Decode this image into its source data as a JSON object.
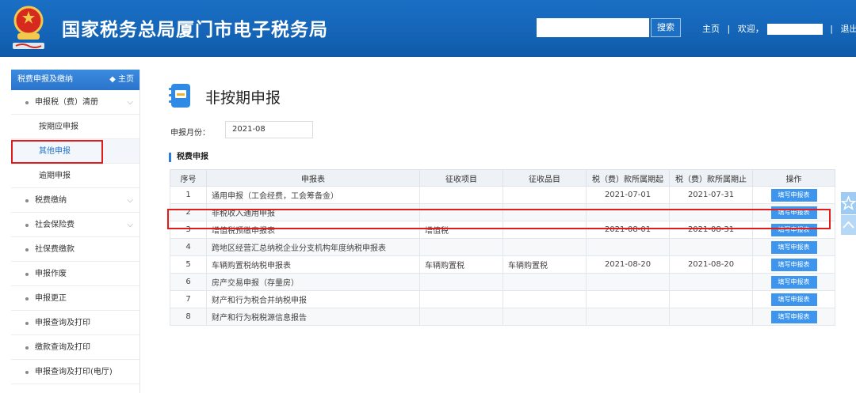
{
  "header": {
    "title": "国家税务总局厦门市电子税务局",
    "search_button": "搜索",
    "nav_home": "主页",
    "nav_sep": "|",
    "nav_welcome": "欢迎，",
    "nav_logout": "退出",
    "brand_color": "#1565b8"
  },
  "sidebar": {
    "head_label": "税费申报及缴纳",
    "head_home": "主页",
    "groups": [
      {
        "label": "申报税（费）清册",
        "chevron": "⌵"
      },
      {
        "label": "税费缴纳",
        "chevron": "⌵"
      },
      {
        "label": "社会保险费",
        "chevron": "⌵"
      },
      {
        "label": "社保费缴款"
      },
      {
        "label": "申报作废"
      },
      {
        "label": "申报更正"
      },
      {
        "label": "申报查询及打印"
      },
      {
        "label": "缴款查询及打印"
      },
      {
        "label": "申报查询及打印(电厅)"
      }
    ],
    "subitems": [
      {
        "label": "按期应申报"
      },
      {
        "label": "其他申报"
      },
      {
        "label": "逾期申报"
      }
    ]
  },
  "main": {
    "page_title": "非按期申报",
    "month_label": "申报月份：",
    "month_value": "2021-08",
    "section_title": "税费申报",
    "columns": [
      "序号",
      "申报表",
      "征收项目",
      "征收品目",
      "税（费）款所属期起",
      "税（费）款所属期止",
      "操作"
    ],
    "action_label": "填写申报表",
    "rows": [
      {
        "no": "1",
        "form": "通用申报（工会经费，工会筹备金）",
        "item": "",
        "subitem": "",
        "start": "2021-07-01",
        "end": "2021-07-31"
      },
      {
        "no": "2",
        "form": "非税收入通用申报",
        "item": "",
        "subitem": "",
        "start": "",
        "end": ""
      },
      {
        "no": "3",
        "form": "增值税预缴申报表",
        "item": "增值税",
        "subitem": "",
        "start": "2021-08-01",
        "end": "2021-08-31"
      },
      {
        "no": "4",
        "form": "跨地区经营汇总纳税企业分支机构年度纳税申报表",
        "item": "",
        "subitem": "",
        "start": "",
        "end": ""
      },
      {
        "no": "5",
        "form": "车辆购置税纳税申报表",
        "item": "车辆购置税",
        "subitem": "车辆购置税",
        "start": "2021-08-20",
        "end": "2021-08-20"
      },
      {
        "no": "6",
        "form": "房产交易申报（存量房）",
        "item": "",
        "subitem": "",
        "start": "",
        "end": ""
      },
      {
        "no": "7",
        "form": "财产和行为税合并纳税申报",
        "item": "",
        "subitem": "",
        "start": "",
        "end": ""
      },
      {
        "no": "8",
        "form": "财产和行为税税源信息报告",
        "item": "",
        "subitem": "",
        "start": "",
        "end": ""
      }
    ]
  },
  "highlight_color": "#e21b1b"
}
